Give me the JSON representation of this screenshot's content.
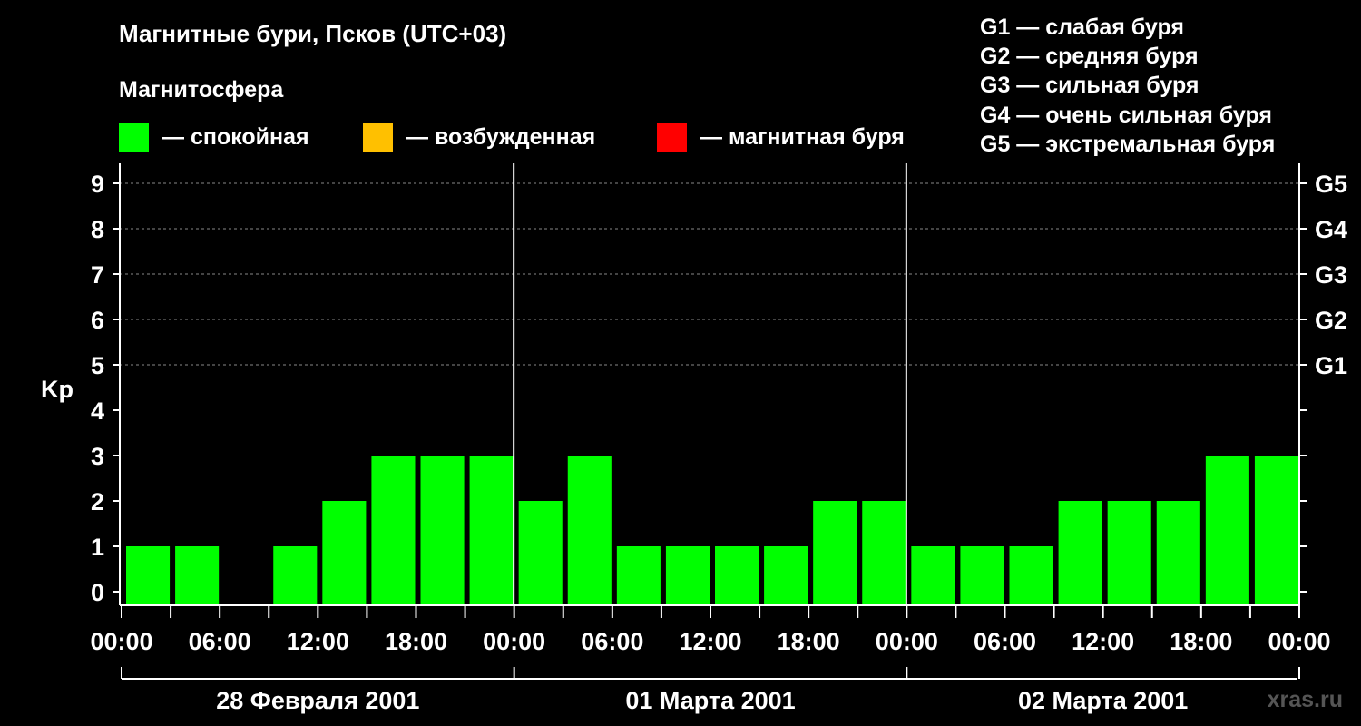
{
  "title": "Магнитные бури, Псков (UTC+03)",
  "subtitle": "Магнитосфера",
  "legend": [
    {
      "color": "#00ff00",
      "label": "— спокойная"
    },
    {
      "color": "#ffc000",
      "label": "— возбужденная"
    },
    {
      "color": "#ff0000",
      "label": "— магнитная буря"
    }
  ],
  "g_scale": [
    "G1 — слабая буря",
    "G2 — средняя буря",
    "G3 — сильная буря",
    "G4 — очень сильная буря",
    "G5 — экстремальная буря"
  ],
  "watermark": "xras.ru",
  "chart_data": {
    "type": "bar",
    "ylabel": "Kp",
    "ylim": [
      0,
      9
    ],
    "y_ticks": [
      "0",
      "1",
      "2",
      "3",
      "4",
      "5",
      "6",
      "7",
      "8",
      "9"
    ],
    "right_ticks": [
      {
        "level": 5,
        "label": "G1"
      },
      {
        "level": 6,
        "label": "G2"
      },
      {
        "level": 7,
        "label": "G3"
      },
      {
        "level": 8,
        "label": "G4"
      },
      {
        "level": 9,
        "label": "G5"
      }
    ],
    "x_tick_labels": [
      "00:00",
      "06:00",
      "12:00",
      "18:00",
      "00:00",
      "06:00",
      "12:00",
      "18:00",
      "00:00",
      "06:00",
      "12:00",
      "18:00",
      "00:00"
    ],
    "days": [
      "28 Февраля 2001",
      "01 Марта 2001",
      "02 Марта 2001"
    ],
    "interval_hours": 3,
    "values": [
      1,
      1,
      0,
      1,
      2,
      3,
      3,
      3,
      2,
      3,
      1,
      1,
      1,
      1,
      2,
      2,
      1,
      1,
      1,
      2,
      2,
      2,
      3,
      3
    ],
    "bar_color": "#00ff00",
    "grid": true
  }
}
